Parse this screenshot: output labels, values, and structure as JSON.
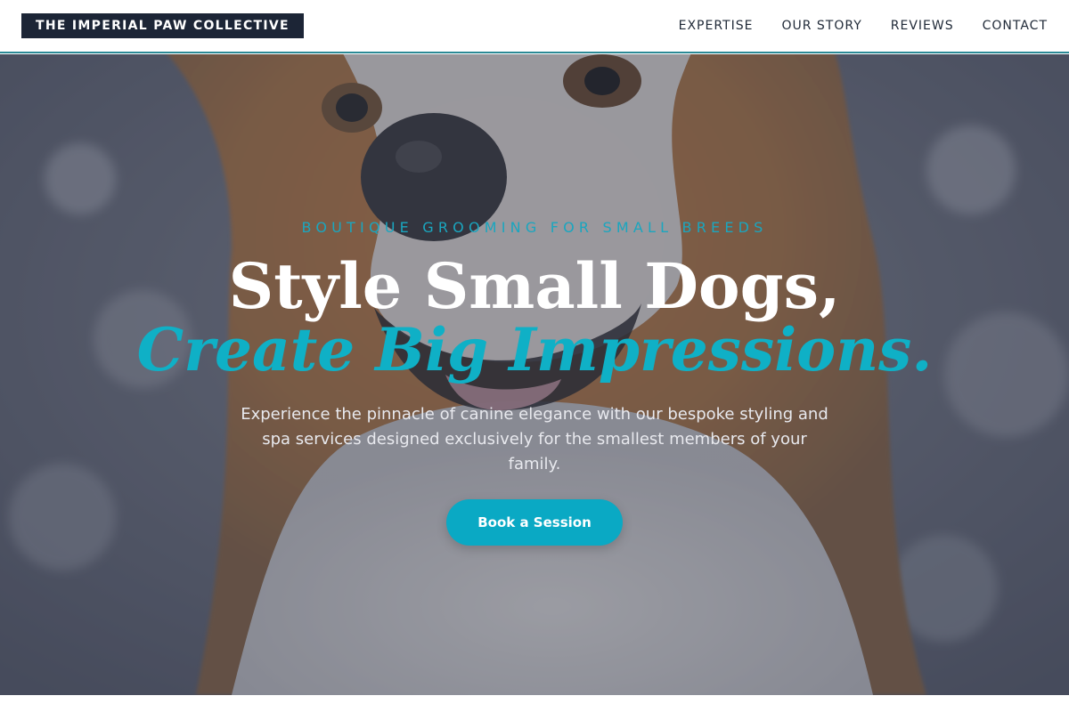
{
  "brand": {
    "logo_text": "THE IMPERIAL PAW COLLECTIVE"
  },
  "nav": {
    "items": [
      {
        "label": "EXPERTISE"
      },
      {
        "label": "OUR STORY"
      },
      {
        "label": "REVIEWS"
      },
      {
        "label": "CONTACT"
      }
    ]
  },
  "hero": {
    "eyebrow": "BOUTIQUE GROOMING FOR SMALL BREEDS",
    "title_line1": "Style Small Dogs,",
    "title_line2": "Create Big Impressions.",
    "description": "Experience the pinnacle of canine elegance with our bespoke styling and spa services designed exclusively for the smallest members of your family.",
    "cta_label": "Book a Session",
    "image_subject": "close-up photo of a smiling corgi-like dog with orange and white fur"
  },
  "colors": {
    "logo_background": "#1c2536",
    "accent": "#0aa9c4",
    "header_border": "#2a8a96",
    "overlay": "#282e40"
  }
}
